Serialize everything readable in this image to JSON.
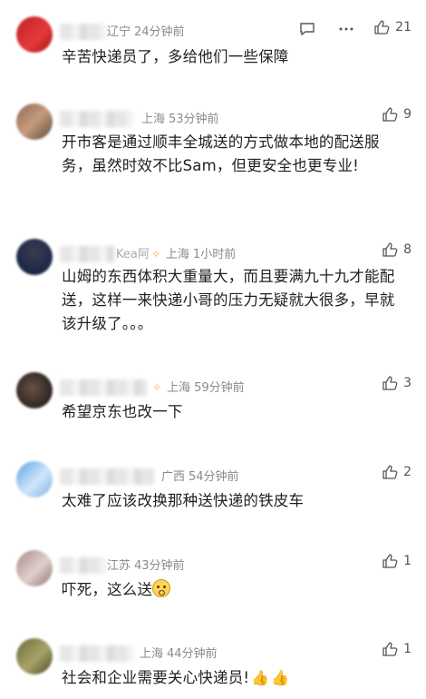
{
  "comments": [
    {
      "location": "辽宁",
      "time": "24分钟前",
      "likes": "21",
      "text": "辛苦快递员了，多给他们一些保障",
      "name_partial": "辽宁"
    },
    {
      "location": "上海",
      "time": "53分钟前",
      "likes": "9",
      "text": "开市客是通过顺丰全城送的方式做本地的配送服务，虽然时效不比Sam，但更安全也更专业!"
    },
    {
      "location": "上海",
      "time": "1小时前",
      "likes": "8",
      "text": "山姆的东西体积大重量大，而且要满九十九才能配送，这样一来快递小哥的压力无疑就大很多，早就该升级了。。。",
      "name_partial": "Kea阿"
    },
    {
      "location": "上海",
      "time": "59分钟前",
      "likes": "3",
      "text": "希望京东也改一下"
    },
    {
      "location": "广西",
      "time": "54分钟前",
      "likes": "2",
      "text": "太难了应该改换那种送快递的铁皮车"
    },
    {
      "location": "江苏",
      "time": "43分钟前",
      "likes": "1",
      "text": "吓死，这么送",
      "name_partial": "江苏"
    },
    {
      "location": "上海",
      "time": "44分钟前",
      "likes": "1",
      "text": "社会和企业需要关心快递员!"
    }
  ],
  "icons": {
    "like": "thumbs-up-icon",
    "comment": "comment-icon",
    "more": "more-icon"
  },
  "colors": {
    "meta": "#8a8a8a",
    "text": "#1f1f1f"
  }
}
